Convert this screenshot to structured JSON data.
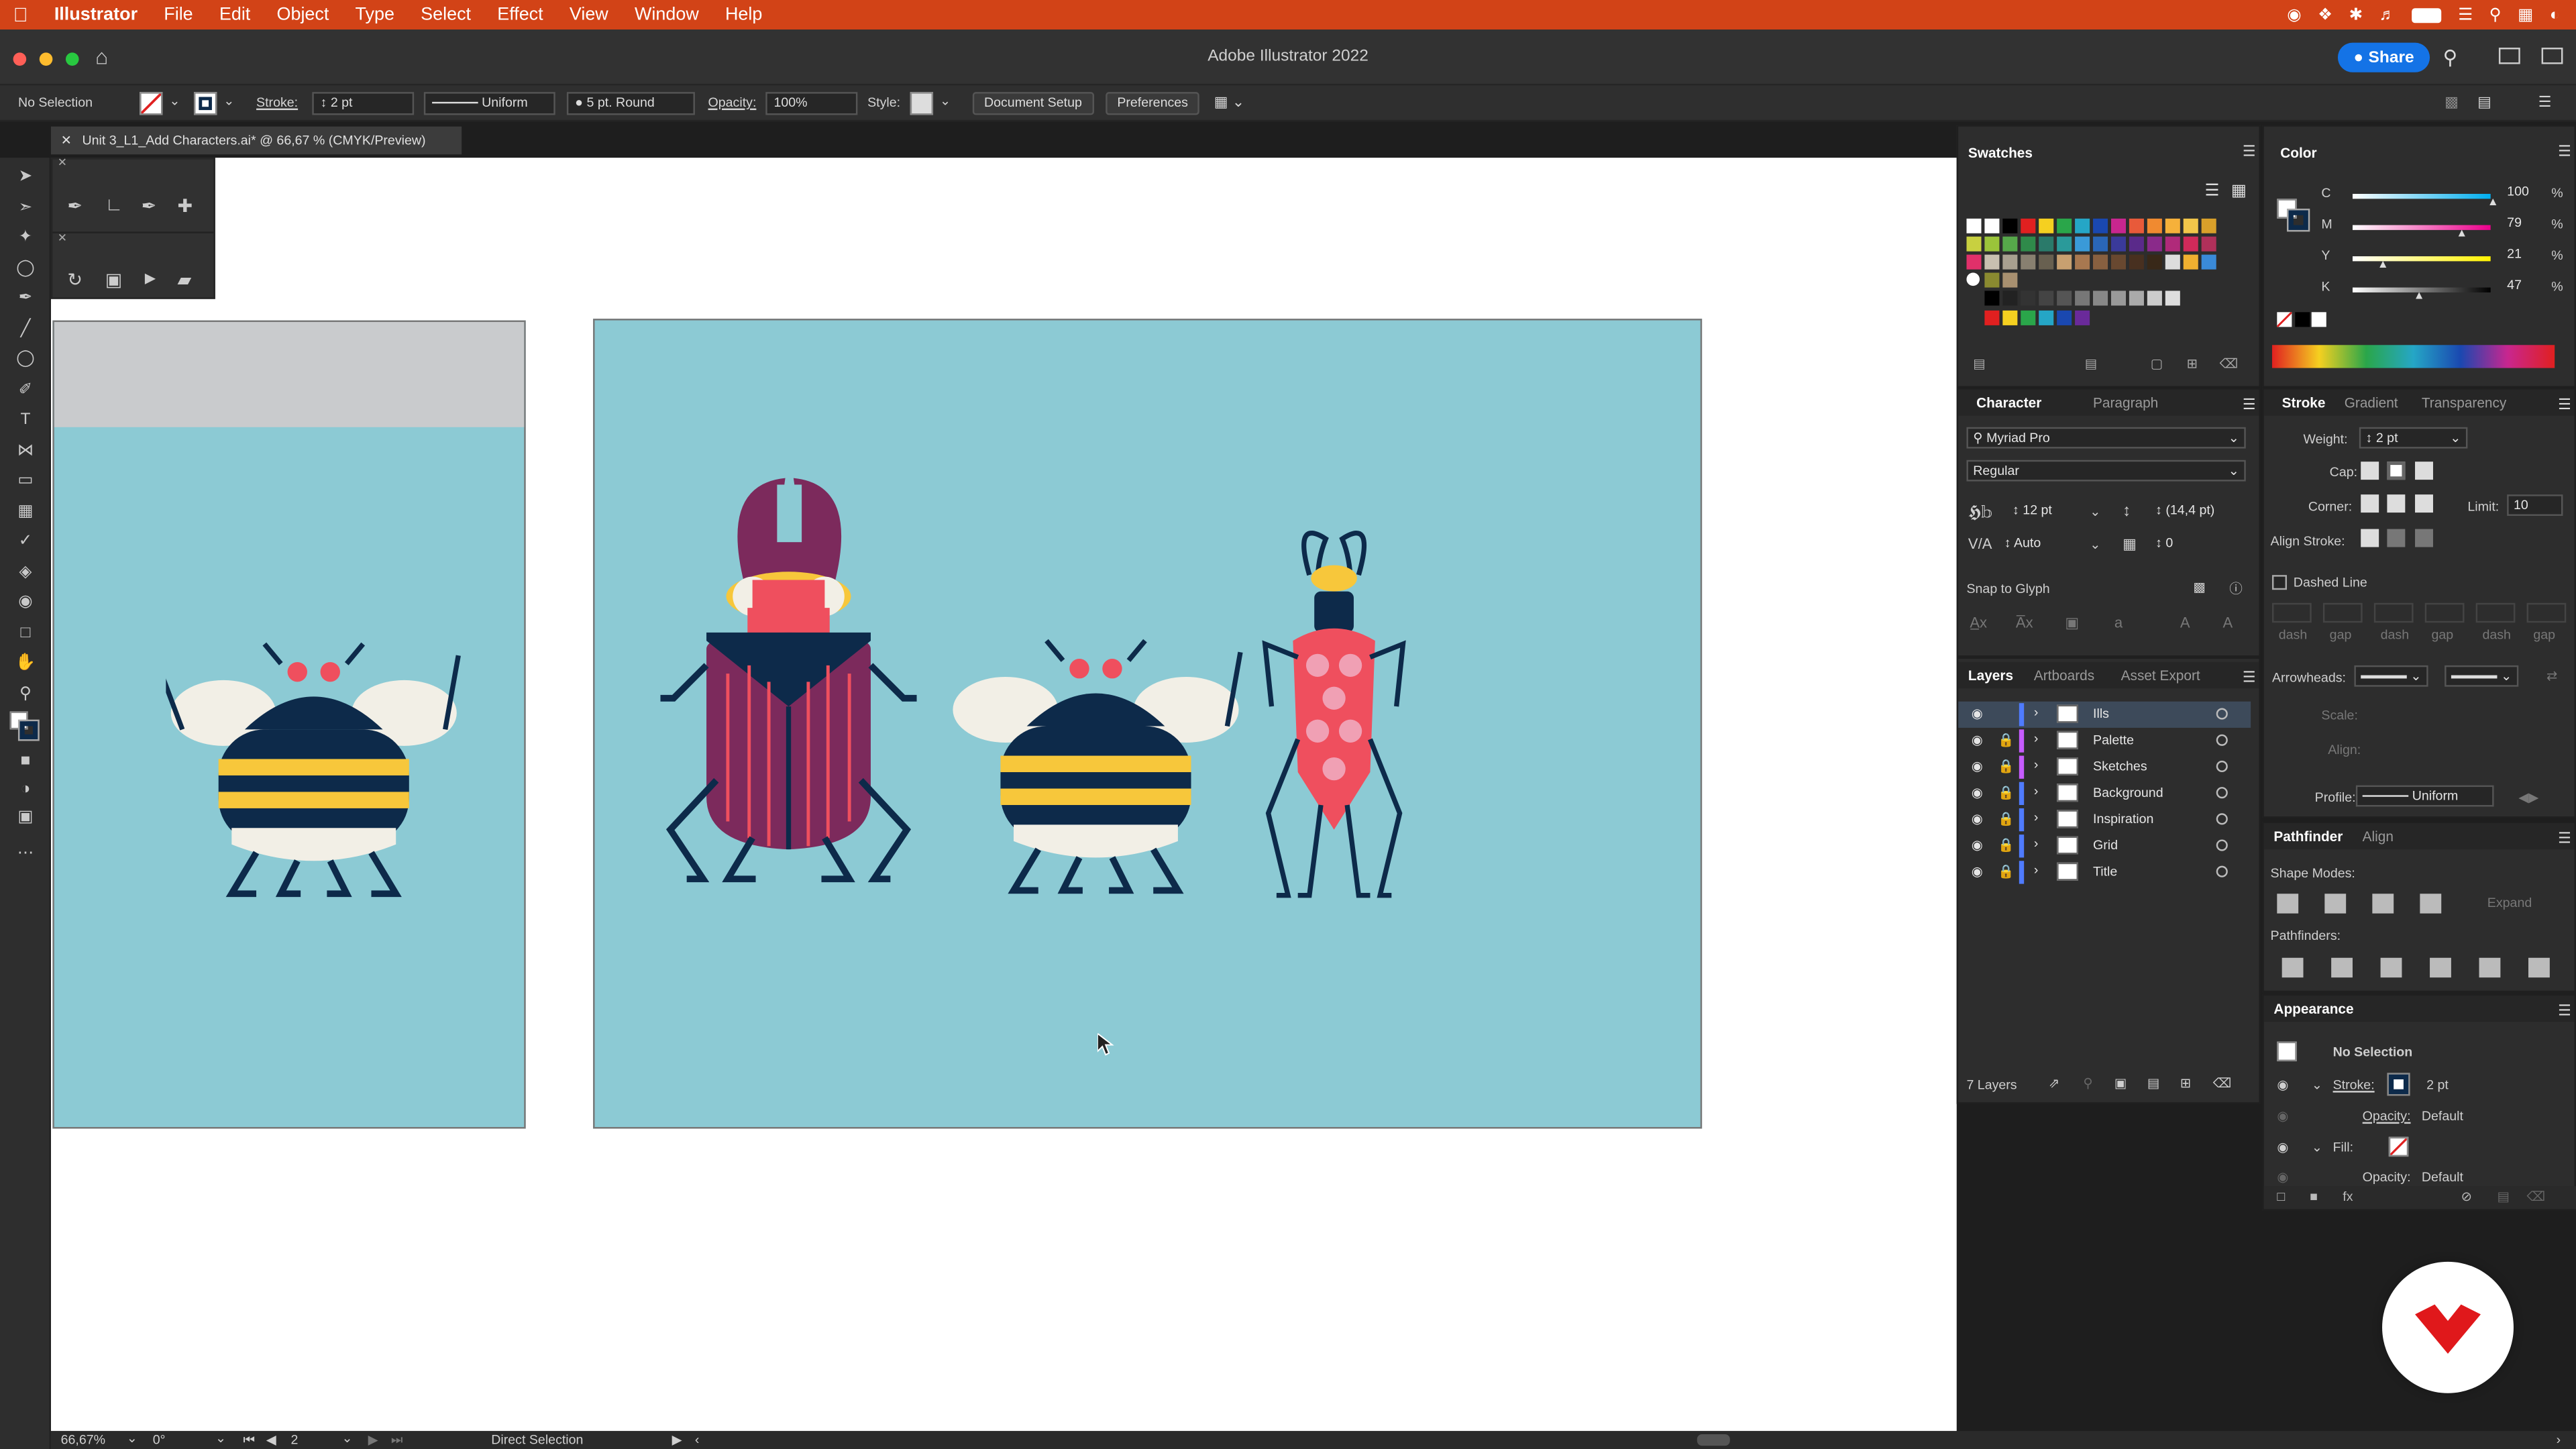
{
  "menubar": {
    "apple_icon": "apple-icon",
    "app_name": "Illustrator",
    "items": [
      "File",
      "Edit",
      "Object",
      "Type",
      "Select",
      "Effect",
      "View",
      "Window",
      "Help"
    ]
  },
  "window": {
    "title": "Adobe Illustrator 2022",
    "share_label": "Share"
  },
  "control_bar": {
    "selection": "No Selection",
    "stroke_label": "Stroke:",
    "stroke_value": "2 pt",
    "profile_value": "Uniform",
    "brush_value": "5 pt. Round",
    "opacity_label": "Opacity:",
    "opacity_value": "100%",
    "style_label": "Style:",
    "document_setup": "Document Setup",
    "preferences": "Preferences"
  },
  "document": {
    "tab_title": "Unit 3_L1_Add Characters.ai* @ 66,67 % (CMYK/Preview)"
  },
  "swatches_panel": {
    "title": "Swatches"
  },
  "color_panel": {
    "title": "Color",
    "channels": [
      {
        "label": "C",
        "value": "100"
      },
      {
        "label": "M",
        "value": "79"
      },
      {
        "label": "Y",
        "value": "21"
      },
      {
        "label": "K",
        "value": "47"
      }
    ],
    "unit": "%"
  },
  "character_panel": {
    "tabs": [
      "Character",
      "Paragraph"
    ],
    "font_family": "Myriad Pro",
    "font_style": "Regular",
    "font_size": "12 pt",
    "leading": "(14,4 pt)",
    "kerning": "Auto",
    "tracking": "0",
    "snap_to_glyph": "Snap to Glyph"
  },
  "stroke_panel": {
    "tabs": [
      "Stroke",
      "Gradient",
      "Transparency"
    ],
    "weight_label": "Weight:",
    "weight_value": "2 pt",
    "cap_label": "Cap:",
    "corner_label": "Corner:",
    "limit_label": "Limit:",
    "limit_value": "10",
    "align_stroke_label": "Align Stroke:",
    "dashed_line_label": "Dashed Line",
    "dash_gap_labels": [
      "dash",
      "gap",
      "dash",
      "gap",
      "dash",
      "gap"
    ],
    "arrowheads_label": "Arrowheads:",
    "scale_label": "Scale:",
    "align_label": "Align:",
    "profile_label": "Profile:",
    "profile_value": "Uniform"
  },
  "layers_panel": {
    "tabs": [
      "Layers",
      "Artboards",
      "Asset Export"
    ],
    "layers": [
      {
        "name": "Ills",
        "color": "#4f7bff",
        "selected": true,
        "locked": false
      },
      {
        "name": "Palette",
        "color": "#c65bff",
        "selected": false,
        "locked": true
      },
      {
        "name": "Sketches",
        "color": "#c65bff",
        "selected": false,
        "locked": true
      },
      {
        "name": "Background",
        "color": "#4f7bff",
        "selected": false,
        "locked": true
      },
      {
        "name": "Inspiration",
        "color": "#4f7bff",
        "selected": false,
        "locked": true
      },
      {
        "name": "Grid",
        "color": "#4f7bff",
        "selected": false,
        "locked": true
      },
      {
        "name": "Title",
        "color": "#4f7bff",
        "selected": false,
        "locked": true
      }
    ],
    "count_label": "7 Layers"
  },
  "pathfinder_panel": {
    "tabs": [
      "Pathfinder",
      "Align"
    ],
    "shape_modes_label": "Shape Modes:",
    "expand_label": "Expand",
    "pathfinders_label": "Pathfinders:"
  },
  "appearance_panel": {
    "title": "Appearance",
    "selection": "No Selection",
    "stroke_label": "Stroke:",
    "stroke_value": "2 pt",
    "opacity_label": "Opacity:",
    "opacity_value": "Default",
    "fill_label": "Fill:",
    "opacity2_label": "Opacity:",
    "opacity2_value": "Default"
  },
  "status_bar": {
    "zoom": "66,67%",
    "rotation": "0°",
    "artboard": "2",
    "tool": "Direct Selection"
  },
  "colors": {
    "menubar": "#d24317",
    "artboard": "#8ccad4",
    "navy": "#0d2a4a",
    "yellow": "#f7c73b",
    "red": "#ef4f5e",
    "pink": "#f0a0b4",
    "purple": "#7c2a5c",
    "accent": "#1473e6"
  }
}
